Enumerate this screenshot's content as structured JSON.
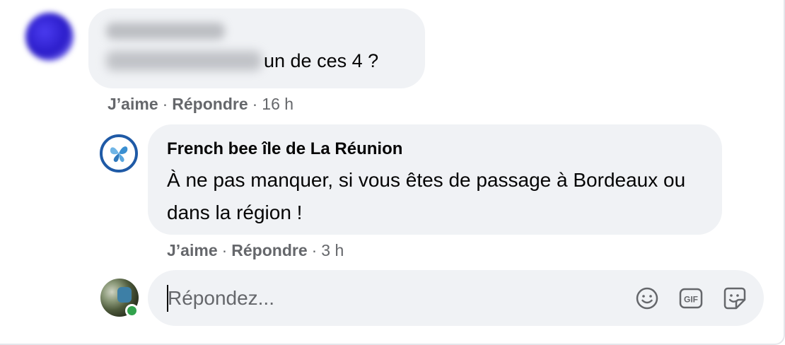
{
  "comment1": {
    "text_tail": "un de ces 4 ?",
    "actions": {
      "like": "J’aime",
      "reply": "Répondre",
      "time": "16 h"
    }
  },
  "reply": {
    "author": "French bee île de La Réunion",
    "text": "À ne pas manquer, si vous êtes de passage à Bordeaux ou dans la région !",
    "actions": {
      "like": "J’aime",
      "reply": "Répondre",
      "time": "3 h"
    }
  },
  "composer": {
    "placeholder": "Répondez...",
    "icons": [
      "emoji-icon",
      "gif-icon",
      "sticker-icon"
    ]
  },
  "colors": {
    "bubble": "#f0f2f5",
    "secondary_text": "#65676b",
    "online": "#31a24c",
    "brand_blue": "#1f5aa6"
  }
}
